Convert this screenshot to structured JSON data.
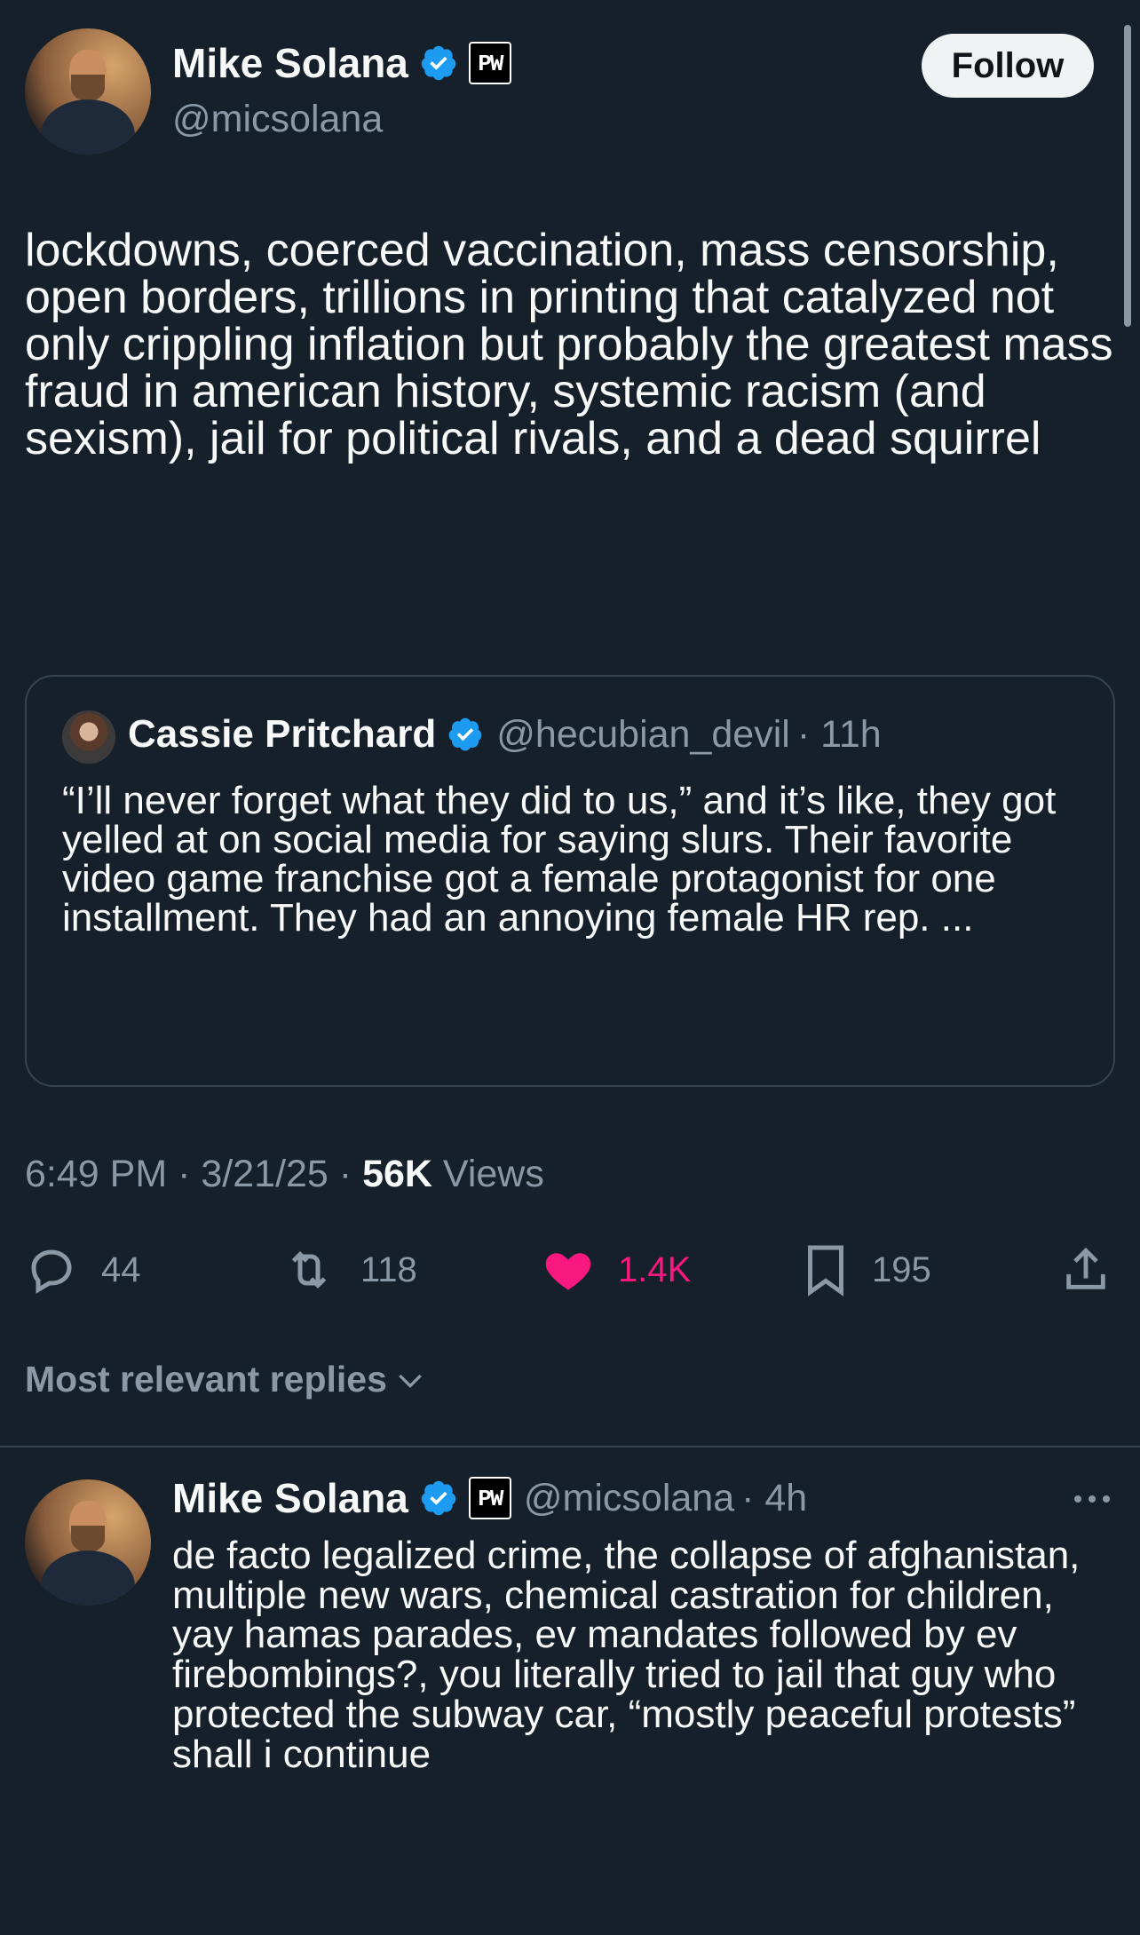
{
  "author": {
    "name": "Mike Solana",
    "handle": "@micsolana",
    "badge": "PW"
  },
  "follow_label": "Follow",
  "tweet": {
    "text": "lockdowns, coerced vaccination, mass censorship, open borders, trillions in printing that catalyzed not only crippling inflation but probably the greatest mass fraud in american history, systemic racism (and sexism), jail for political rivals, and a dead squirrel"
  },
  "quote": {
    "name": "Cassie Pritchard",
    "handle": "@hecubian_devil",
    "time": "· 11h",
    "text": "“I’ll never forget what they did to us,” and it’s like, they got yelled at on social media for saying slurs. Their favorite video game franchise got a female protagonist for one installment. They had an annoying female HR rep. ..."
  },
  "meta": {
    "time": "6:49 PM",
    "date": "3/21/25",
    "views_count": "56K",
    "views_label": "Views"
  },
  "actions": {
    "replies": "44",
    "retweets": "118",
    "likes": "1.4K",
    "bookmarks": "195"
  },
  "replies_header": "Most relevant replies",
  "reply": {
    "name": "Mike Solana",
    "handle": "@micsolana",
    "time": "· 4h",
    "badge": "PW",
    "text": "de facto legalized crime, the collapse of afghanistan, multiple new wars, chemical castration for children, yay hamas parades, ev mandates followed by ev firebombings?, you literally tried to jail that guy who protected the subway car, “mostly peaceful protests” shall i continue"
  },
  "colors": {
    "background": "#15202b",
    "verified": "#1d9bf0",
    "like": "#f91880",
    "secondary_text": "#8b98a5"
  }
}
